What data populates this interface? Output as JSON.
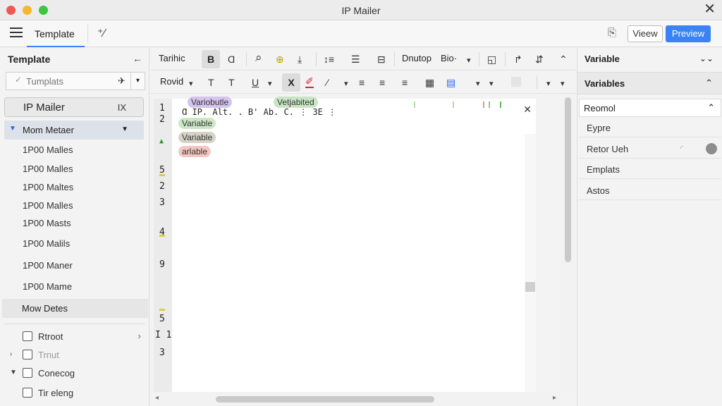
{
  "window": {
    "title": "IP Mailer",
    "close_glyph": "✕"
  },
  "appbar": {
    "tab_label": "Template",
    "mini_glyph": "⁺⁄",
    "doc_glyph": "⎘",
    "view_label": "Vieew",
    "preview_label": "Preview"
  },
  "sidebar": {
    "heading": "Template",
    "back_glyph": "←",
    "search": {
      "placeholder": "Tumplats",
      "pin_glyph": "✈",
      "dropdown_glyph": "▾"
    },
    "mailer": {
      "label": "IP Mailer",
      "x_label": "IX"
    },
    "selected": {
      "label": "Mom Metaer",
      "arrow": "▼",
      "dropdown": "▼"
    },
    "items": [
      {
        "label": "1P00 Malles"
      },
      {
        "label": "1P00 Malles"
      },
      {
        "label": "1P00 Maltes"
      },
      {
        "label": "1P00 Malles"
      },
      {
        "label": "1P00 Masts"
      },
      {
        "label": "1P00 Malils"
      },
      {
        "label": "1P00 Maner"
      },
      {
        "label": "1P00 Mame"
      }
    ],
    "details_label": "Mow Detes",
    "checks": [
      {
        "label": "Rtroot",
        "expander": "",
        "chevron": "›"
      },
      {
        "label": "Trnut",
        "expander": "›",
        "chevron": ""
      },
      {
        "label": "Conecog",
        "expander": "▼",
        "chevron": ""
      },
      {
        "label": "Tir eleng",
        "expander": "",
        "chevron": ""
      }
    ]
  },
  "toolbar1": {
    "font_label": "Tarihic",
    "bold": "B",
    "italic": "Ɑ",
    "search": "⌕",
    "paint": "⊕",
    "download": "⤓",
    "indent": "↕≡",
    "list": "☰",
    "checklist": "⊟",
    "dnutop_label": "Dnutop",
    "bio_label": "Bio·",
    "bio_dd": "▾",
    "comment": "◱",
    "redo": "↱",
    "swap": "⇵",
    "collapse": "⌃"
  },
  "toolbar2": {
    "style_label": "Rovid",
    "style_dd": "▾",
    "t1": "T",
    "t2": "T",
    "underline": "U",
    "underline_dd": "▾",
    "clear": "X",
    "pen": "✐",
    "pen2": "⁄",
    "pen2_dd": "▾",
    "align_left": "≡",
    "align_center": "≡",
    "align_right": "≡",
    "table": "▦",
    "image": "▤",
    "dd1": "▾",
    "dd2": "▾",
    "dd3": "▾",
    "dd4": "▾"
  },
  "editor": {
    "line_numbers": [
      "1",
      "2",
      "",
      "5",
      "2",
      "3",
      "4",
      "9",
      "5",
      "I 1",
      "3"
    ],
    "gutter_glyph": "▲",
    "code_line": "Ɑ IP. Alt. . B' Ab.  C.  ⋮  3E  ⋮",
    "chips": {
      "variable1": "Variobutle",
      "variable2": "Vetjabited",
      "variable3": "Variable",
      "variable4": "Variable",
      "variable5": "arlable"
    },
    "close_glyph": "✕",
    "scroll_left": "◂",
    "scroll_right": "▸"
  },
  "rightpanel": {
    "header1": "Variable",
    "header1_icon": "⌄⌄",
    "header2": "Variables",
    "header2_chevron": "⌃",
    "section": "Reomol",
    "section_chevron": "⌃",
    "items": [
      {
        "label": "Eypre"
      },
      {
        "label": "Retor Ueh"
      },
      {
        "label": "Emplats"
      },
      {
        "label": "Astos"
      }
    ],
    "spinner_glyph": "◜"
  },
  "colors": {
    "accent": "#3b82f6",
    "chip_violet": "#d4c4ee",
    "chip_green": "#c9e6c4",
    "chip_tan": "#d6d3c6",
    "chip_pink": "#f3c6c0"
  }
}
